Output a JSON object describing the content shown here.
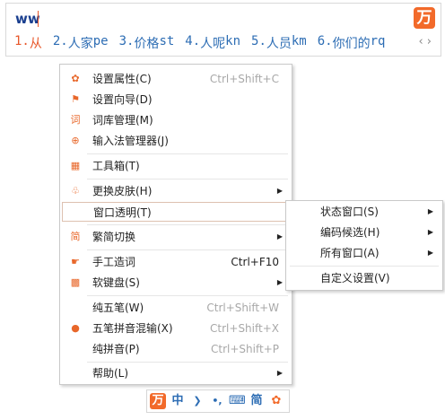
{
  "composition": {
    "text": "ww"
  },
  "candidates": [
    {
      "num": "1.",
      "word": "从",
      "code": ""
    },
    {
      "num": "2.",
      "word": "人家",
      "code": "pe"
    },
    {
      "num": "3.",
      "word": "价格",
      "code": "st"
    },
    {
      "num": "4.",
      "word": "人呢",
      "code": "kn"
    },
    {
      "num": "5.",
      "word": "人员",
      "code": "km"
    },
    {
      "num": "6.",
      "word": "你们的",
      "code": "rq"
    }
  ],
  "nav": {
    "prev": "‹",
    "next": "›"
  },
  "logo": {
    "glyph": "万",
    "icon": "wubi-logo-icon",
    "color": "#f26a2a"
  },
  "menu": {
    "items": [
      {
        "label": "设置属性(C)",
        "shortcut": "Ctrl+Shift+C",
        "icon": "gear-icon"
      },
      {
        "label": "设置向导(D)",
        "shortcut": "",
        "icon": "flag-icon"
      },
      {
        "label": "词库管理(M)",
        "shortcut": "",
        "icon": "dictionary-icon"
      },
      {
        "label": "输入法管理器(J)",
        "shortcut": "",
        "icon": "manager-icon"
      },
      {
        "label": "工具箱(T)",
        "shortcut": "",
        "icon": "toolbox-icon"
      },
      {
        "label": "更换皮肤(H)",
        "shortcut": "",
        "icon": "shirt-icon"
      },
      {
        "label": "窗口透明(T)",
        "shortcut": "",
        "icon": ""
      },
      {
        "label": "繁简切换",
        "shortcut": "",
        "icon": "traditional-simplified-icon"
      },
      {
        "label": "手工造词",
        "shortcut": "Ctrl+F10",
        "icon": "hand-icon"
      },
      {
        "label": "软键盘(S)",
        "shortcut": "",
        "icon": "keyboard-icon"
      },
      {
        "label": "纯五笔(W)",
        "shortcut": "Ctrl+Shift+W",
        "icon": ""
      },
      {
        "label": "五笔拼音混输(X)",
        "shortcut": "Ctrl+Shift+X",
        "icon": "selected-dot-icon"
      },
      {
        "label": "纯拼音(P)",
        "shortcut": "Ctrl+Shift+P",
        "icon": ""
      },
      {
        "label": "帮助(L)",
        "shortcut": "",
        "icon": ""
      }
    ]
  },
  "submenu": {
    "items": [
      {
        "label": "状态窗口(S)"
      },
      {
        "label": "编码候选(H)"
      },
      {
        "label": "所有窗口(A)"
      },
      {
        "label": "自定义设置(V)"
      }
    ]
  },
  "status_bar": {
    "logo": "万",
    "mode": "中",
    "punct": "❯",
    "width": "•,",
    "keyboard": "⌨",
    "script": "简",
    "settings": "✿"
  },
  "colors": {
    "accent": "#f26a2a",
    "candidate": "#2d6db4",
    "shortcut": "#a8a8a8"
  }
}
